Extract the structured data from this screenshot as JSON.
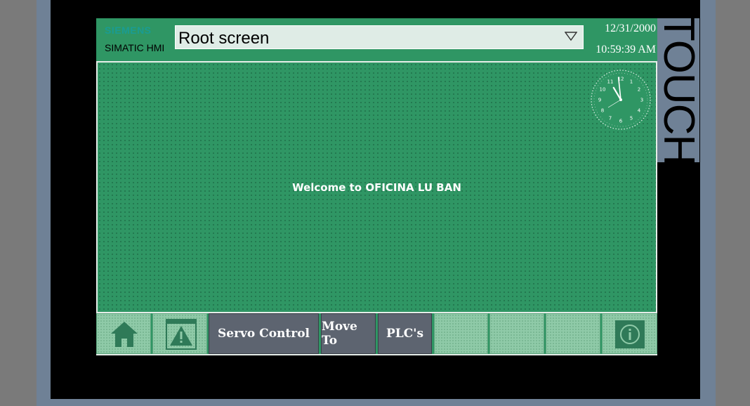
{
  "header": {
    "brand": "SIEMENS",
    "product": "SIMATIC HMI",
    "screen_selector": {
      "value": "Root screen"
    },
    "date": "12/31/2000",
    "time": "10:59:39 AM"
  },
  "device": {
    "label": "TOUCH"
  },
  "main": {
    "welcome_text": "Welcome to OFICINA LU BAN"
  },
  "clock": {
    "numbers": [
      "12",
      "1",
      "2",
      "3",
      "4",
      "5",
      "6",
      "7",
      "8",
      "9",
      "10",
      "11"
    ],
    "time_shown": "10:59"
  },
  "function_keys": [
    {
      "label": "",
      "icon": "home-icon"
    },
    {
      "label": "",
      "icon": "warning-icon"
    },
    {
      "label": "Servo Control"
    },
    {
      "label": "Move To"
    },
    {
      "label": "PLC's"
    },
    {
      "label": ""
    },
    {
      "label": ""
    },
    {
      "label": ""
    },
    {
      "label": "",
      "icon": "info-icon"
    }
  ],
  "colors": {
    "screen_green": "#2f9664",
    "button_gray": "#5d6470",
    "key_light_green": "#8fcaa8",
    "bezel": "#000000",
    "frame": "#6f8196"
  }
}
